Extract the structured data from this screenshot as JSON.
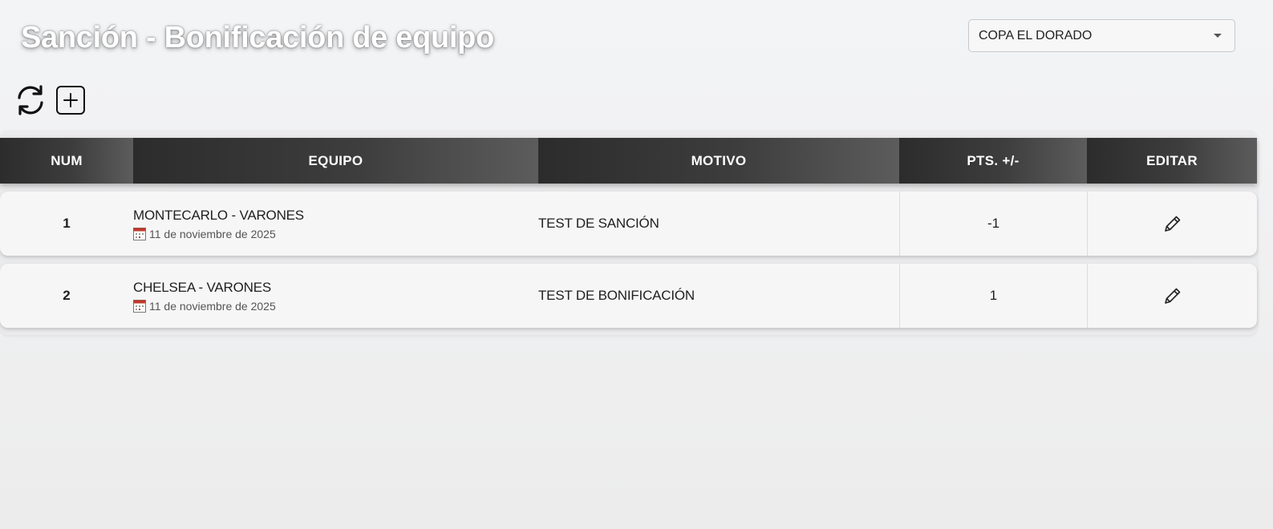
{
  "page": {
    "title": "Sanción - Bonificación de equipo"
  },
  "tournament_select": {
    "selected": "COPA EL DORADO"
  },
  "toolbar": {
    "refresh_icon": "refresh-icon",
    "add_icon": "plus-square-icon"
  },
  "table": {
    "headers": [
      "NUM",
      "EQUIPO",
      "MOTIVO",
      "PTS. +/-",
      "EDITAR"
    ],
    "rows": [
      {
        "num": "1",
        "team": "MONTECARLO - VARONES",
        "date": "11 de noviembre de 2025",
        "reason": "TEST DE SANCIÓN",
        "points": "-1"
      },
      {
        "num": "2",
        "team": "CHELSEA - VARONES",
        "date": "11 de noviembre de 2025",
        "reason": "TEST DE BONIFICACIÓN",
        "points": "1"
      }
    ]
  },
  "colors": {
    "header_dark": "#2c2c2c",
    "header_light": "#5c5c5c",
    "calendar_red": "#c0392b"
  }
}
